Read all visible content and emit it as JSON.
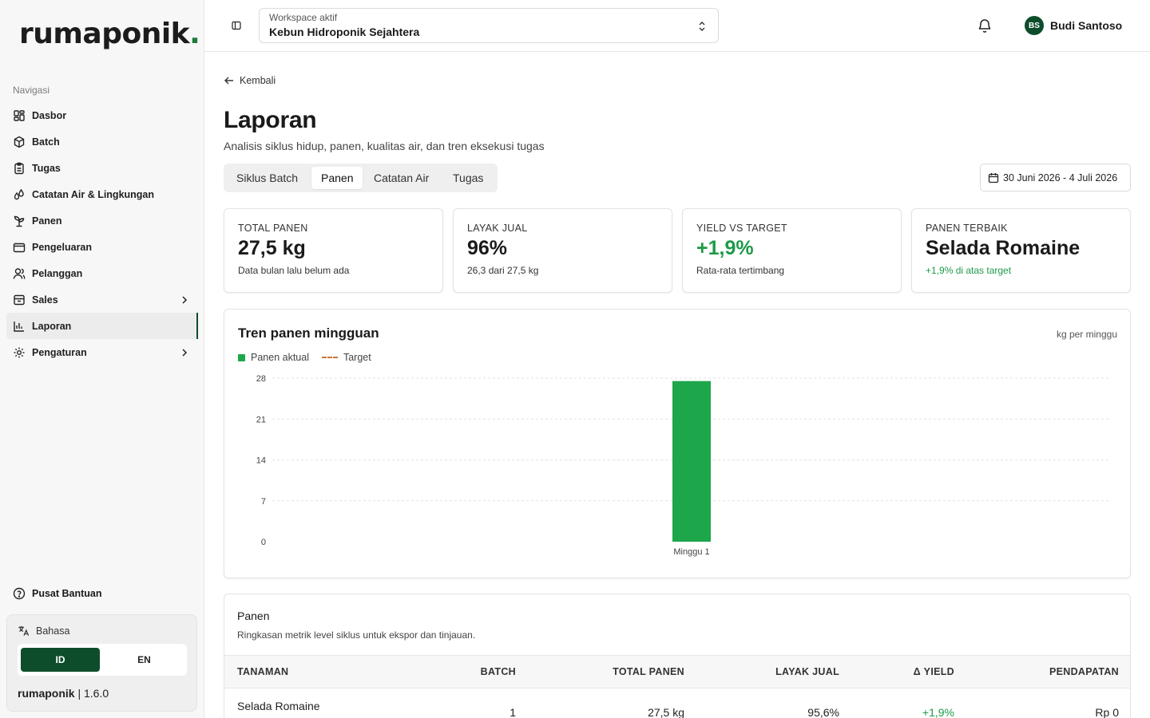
{
  "sidebar": {
    "logo": "rumaponik",
    "logo_dot": ".",
    "nav_title": "Navigasi",
    "items": [
      {
        "label": "Dasbor",
        "icon": "dashboard-icon"
      },
      {
        "label": "Batch",
        "icon": "box-icon"
      },
      {
        "label": "Tugas",
        "icon": "clipboard-icon"
      },
      {
        "label": "Catatan Air & Lingkungan",
        "icon": "droplets-icon"
      },
      {
        "label": "Panen",
        "icon": "sprout-icon"
      },
      {
        "label": "Pengeluaran",
        "icon": "wallet-icon"
      },
      {
        "label": "Pelanggan",
        "icon": "users-icon"
      },
      {
        "label": "Sales",
        "icon": "inbox-icon"
      },
      {
        "label": "Laporan",
        "icon": "bar-chart-icon"
      },
      {
        "label": "Pengaturan",
        "icon": "gear-icon"
      }
    ],
    "help": "Pusat Bantuan",
    "language_label": "Bahasa",
    "lang_id": "ID",
    "lang_en": "EN",
    "app_name": "rumaponik",
    "version": "1.6.0"
  },
  "header": {
    "workspace_label": "Workspace aktif",
    "workspace_value": "Kebun Hidroponik Sejahtera",
    "avatar_initials": "BS",
    "user_name": "Budi Santoso"
  },
  "main": {
    "back": "Kembali",
    "title": "Laporan",
    "subtitle": "Analisis siklus hidup, panen, kualitas air, dan tren eksekusi tugas",
    "tabs": [
      "Siklus Batch",
      "Panen",
      "Catatan Air",
      "Tugas"
    ],
    "active_tab": "Panen",
    "date_range": "30 Juni 2026 - 4 Juli 2026"
  },
  "cards": [
    {
      "label": "TOTAL PANEN",
      "value": "27,5 kg",
      "note": "Data bulan lalu belum ada"
    },
    {
      "label": "LAYAK JUAL",
      "value": "96%",
      "note": "26,3 dari 27,5 kg"
    },
    {
      "label": "YIELD VS TARGET",
      "value": "+1,9%",
      "note": "Rata-rata tertimbang"
    },
    {
      "label": "PANEN TERBAIK",
      "value": "Selada Romaine",
      "note": "+1,9% di atas target"
    }
  ],
  "chart": {
    "title": "Tren panen mingguan",
    "unit": "kg per minggu",
    "legend_actual": "Panen aktual",
    "legend_target": "Target"
  },
  "chart_data": {
    "type": "bar",
    "categories": [
      "Minggu 1"
    ],
    "series": [
      {
        "name": "Panen aktual",
        "values": [
          27.5
        ]
      },
      {
        "name": "Target",
        "values": []
      }
    ],
    "yticks": [
      0,
      7,
      14,
      21,
      28
    ],
    "ylim": [
      0,
      28
    ],
    "grid": true,
    "legend": "top-left",
    "colors": {
      "actual": "#1ea64a",
      "target": "#c9773a"
    }
  },
  "table": {
    "title": "Panen",
    "subtitle": "Ringkasan metrik level siklus untuk ekspor dan tinjauan.",
    "columns": [
      "TANAMAN",
      "BATCH",
      "TOTAL PANEN",
      "LAYAK JUAL",
      "Δ YIELD",
      "PENDAPATAN"
    ],
    "rows": [
      {
        "tanaman": "Selada Romaine",
        "batch": "1",
        "total": "27,5 kg",
        "layak": "95,6%",
        "yield": "+1,9%",
        "pendapatan": "Rp 0"
      }
    ]
  }
}
